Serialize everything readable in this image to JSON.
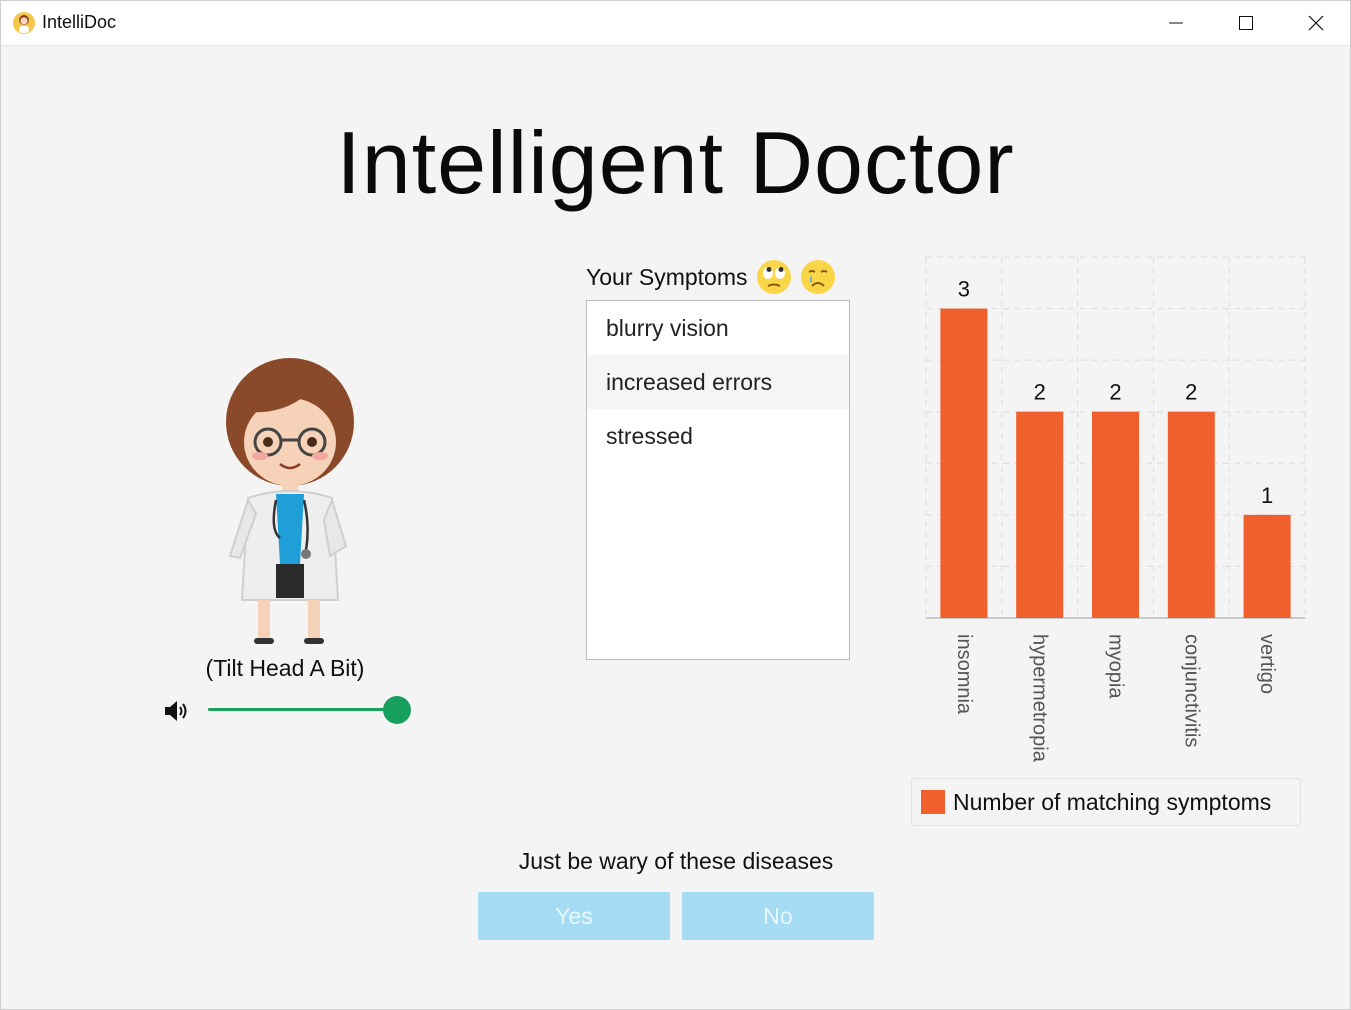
{
  "window": {
    "title": "IntelliDoc",
    "app_icon": "doctor-avatar-icon"
  },
  "main": {
    "title": "Intelligent Doctor"
  },
  "assistant": {
    "caption": "(Tilt Head A Bit)",
    "volume_icon": "speaker-icon",
    "volume_level": 1.0
  },
  "symptoms": {
    "title": "Your Symptoms",
    "emojis": [
      "eye-roll-emoji",
      "crying-face-emoji"
    ],
    "items": [
      "blurry vision",
      "increased errors",
      "stressed"
    ]
  },
  "chart_data": {
    "type": "bar",
    "categories": [
      "insomnia",
      "hypermetropia",
      "myopia",
      "conjunctivitis",
      "vertigo"
    ],
    "values": [
      3,
      2,
      2,
      2,
      1
    ],
    "series": [
      {
        "name": "Number of matching symptoms",
        "values": [
          3,
          2,
          2,
          2,
          1
        ]
      }
    ],
    "ylim": [
      0,
      3.5
    ],
    "grid": true,
    "legend": "bottom",
    "bar_color": "#f0602c"
  },
  "footer": {
    "message": "Just be wary of these diseases",
    "yes_label": "Yes",
    "no_label": "No"
  },
  "colors": {
    "accent": "#17a05d",
    "button": "#a6dcf3",
    "bar": "#f0602c"
  }
}
